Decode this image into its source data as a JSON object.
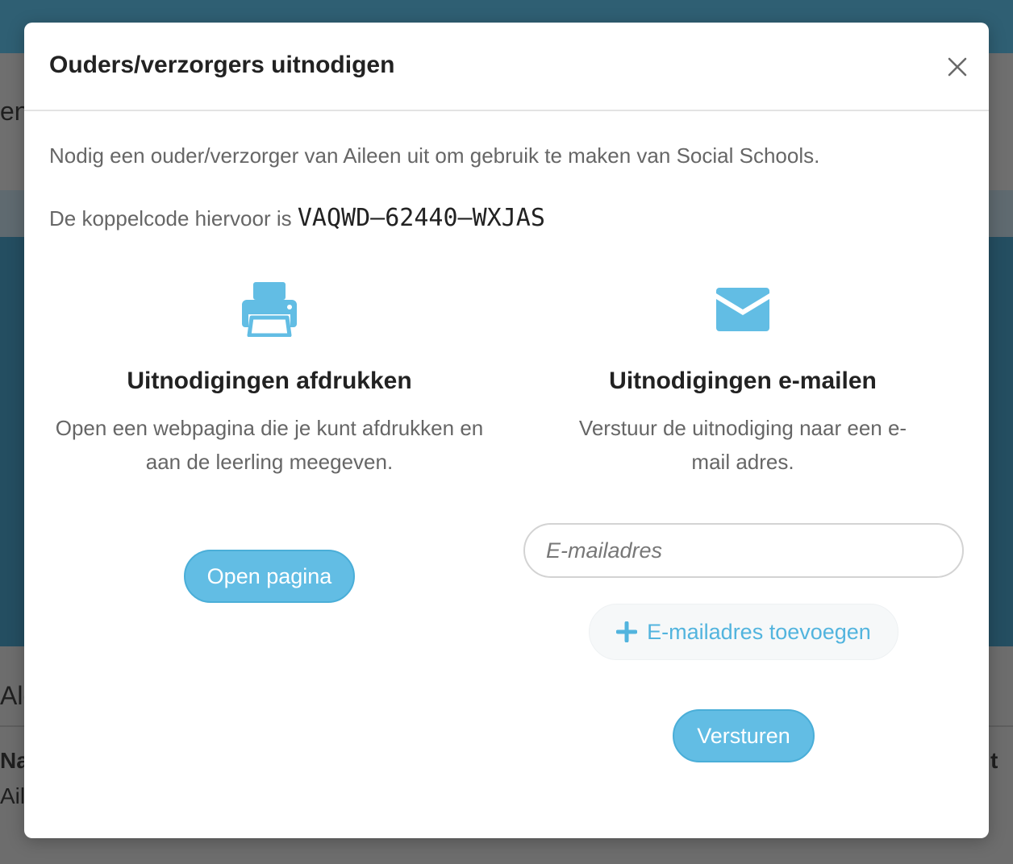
{
  "background": {
    "partial_text_1": "en",
    "partial_text_2": "Alg",
    "partial_text_3": "Naa",
    "partial_text_4": "Aile",
    "partial_text_5": "t"
  },
  "modal": {
    "title": "Ouders/verzorgers uitnodigen",
    "intro": "Nodig een ouder/verzorger van Aileen uit om gebruik te maken van Social Schools.",
    "code_label": "De koppelcode hiervoor is ",
    "code": "VAQWD–62440–WXJAS",
    "print": {
      "icon": "printer-icon",
      "title": "Uitnodigingen afdrukken",
      "description": "Open een webpagina die je kunt afdrukken en aan de leerling meegeven.",
      "button_label": "Open pagina"
    },
    "email": {
      "icon": "envelope-icon",
      "title": "Uitnodigingen e-mailen",
      "description": "Verstuur de uitnodiging naar een e-mail adres.",
      "input_placeholder": "E-mailadres",
      "input_value": "",
      "add_label": "E-mailadres toevoegen",
      "send_label": "Versturen"
    }
  },
  "colors": {
    "accent": "#62bde4",
    "accent_text": "#52b4de",
    "title_text": "#222222",
    "body_text": "#666666"
  }
}
